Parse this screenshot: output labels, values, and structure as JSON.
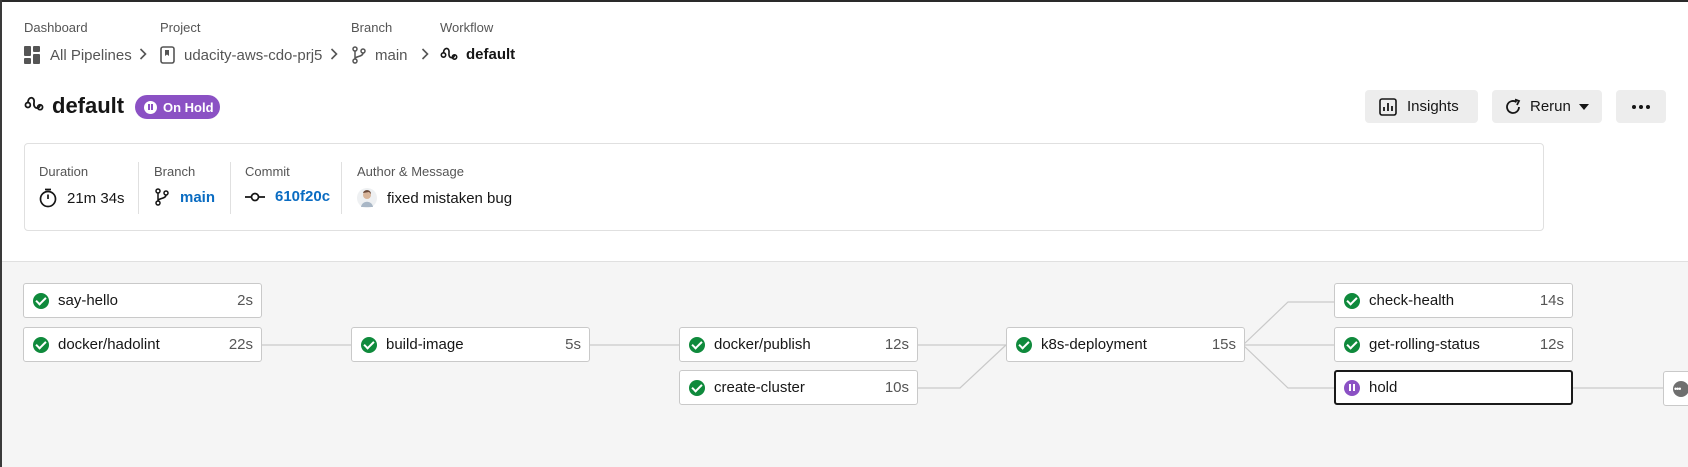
{
  "breadcrumbs": [
    {
      "label": "Dashboard",
      "value": "All Pipelines",
      "icon": "dashboard-icon"
    },
    {
      "label": "Project",
      "value": "udacity-aws-cdo-prj5",
      "icon": "project-icon"
    },
    {
      "label": "Branch",
      "value": "main",
      "icon": "branch-icon"
    },
    {
      "label": "Workflow",
      "value": "default",
      "icon": "workflow-icon"
    }
  ],
  "header": {
    "title": "default",
    "status": "On Hold",
    "status_color": "#8b51c4",
    "insights_label": "Insights",
    "rerun_label": "Rerun",
    "more_icon": "more-icon"
  },
  "summary": {
    "duration_label": "Duration",
    "duration_value": "21m 34s",
    "branch_label": "Branch",
    "branch_value": "main",
    "commit_label": "Commit",
    "commit_value": "610f20c",
    "author_label": "Author & Message",
    "message": "fixed mistaken bug"
  },
  "jobs": [
    {
      "name": "say-hello",
      "duration": "2s",
      "status": "success"
    },
    {
      "name": "docker/hadolint",
      "duration": "22s",
      "status": "success"
    },
    {
      "name": "build-image",
      "duration": "5s",
      "status": "success"
    },
    {
      "name": "docker/publish",
      "duration": "12s",
      "status": "success"
    },
    {
      "name": "create-cluster",
      "duration": "10s",
      "status": "success"
    },
    {
      "name": "k8s-deployment",
      "duration": "15s",
      "status": "success"
    },
    {
      "name": "check-health",
      "duration": "14s",
      "status": "success"
    },
    {
      "name": "get-rolling-status",
      "duration": "12s",
      "status": "success"
    },
    {
      "name": "hold",
      "duration": "",
      "status": "on-hold"
    }
  ],
  "colors": {
    "success": "#0f8a3c",
    "on_hold": "#8b51c4",
    "link": "#0a6cc2"
  }
}
